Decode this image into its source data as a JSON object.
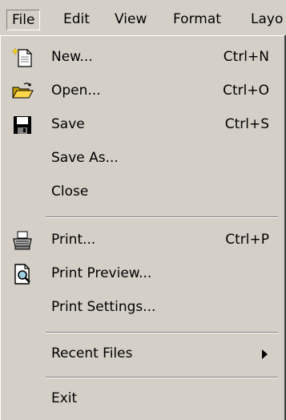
{
  "menubar": {
    "items": [
      "File",
      "Edit",
      "View",
      "Format",
      "Layo"
    ]
  },
  "file_menu": {
    "new": {
      "label": "New...",
      "shortcut": "Ctrl+N",
      "icon": "new-document-icon"
    },
    "open": {
      "label": "Open...",
      "shortcut": "Ctrl+O",
      "icon": "open-folder-icon"
    },
    "save": {
      "label": "Save",
      "shortcut": "Ctrl+S",
      "icon": "floppy-disk-icon"
    },
    "save_as": {
      "label": "Save As..."
    },
    "close": {
      "label": "Close"
    },
    "print": {
      "label": "Print...",
      "shortcut": "Ctrl+P",
      "icon": "printer-icon"
    },
    "print_preview": {
      "label": "Print Preview...",
      "icon": "print-preview-icon"
    },
    "print_settings": {
      "label": "Print Settings..."
    },
    "recent_files": {
      "label": "Recent Files",
      "has_submenu": true
    },
    "exit": {
      "label": "Exit"
    }
  },
  "colors": {
    "face": "#d4d0c8",
    "shadow": "#808080",
    "highlight": "#ffffff"
  }
}
